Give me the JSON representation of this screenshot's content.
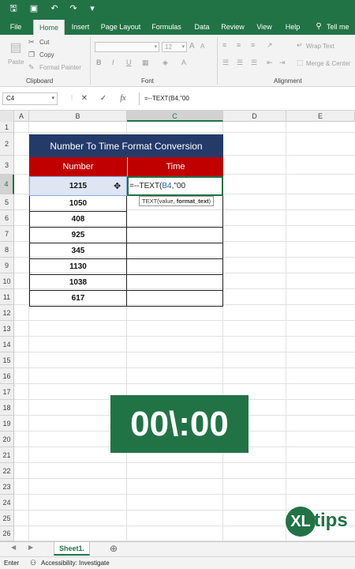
{
  "titlebar": {
    "quick_access": [
      {
        "name": "save-icon",
        "glyph": "🖫"
      },
      {
        "name": "autosave-icon",
        "glyph": "▣"
      },
      {
        "name": "undo-icon",
        "glyph": "↶"
      },
      {
        "name": "redo-icon",
        "glyph": "↷"
      },
      {
        "name": "customize-icon",
        "glyph": "▾"
      }
    ],
    "color": "#217346"
  },
  "ribbon": {
    "tabs": [
      "File",
      "Home",
      "Insert",
      "Page Layout",
      "Formulas",
      "Data",
      "Review",
      "View",
      "Help",
      "Tell me"
    ],
    "active_tab": "Home",
    "clipboard": {
      "paste": "Paste",
      "cut": "Cut",
      "copy": "Copy",
      "format_painter": "Format Painter",
      "label": "Clipboard"
    },
    "font": {
      "size": "12",
      "bold": "B",
      "italic": "I",
      "underline": "U",
      "label": "Font"
    },
    "alignment": {
      "wrap_text": "Wrap Text",
      "merge_center": "Merge & Center",
      "label": "Alignment"
    }
  },
  "formula_bar": {
    "name_box": "C4",
    "cancel": "✕",
    "enter": "✓",
    "fx": "fx",
    "formula": "=--TEXT(B4,\"00"
  },
  "sheet": {
    "columns": [
      "A",
      "B",
      "C",
      "D",
      "E"
    ],
    "selected_column": "C",
    "rows": [
      "1",
      "2",
      "3",
      "4",
      "5",
      "6",
      "7",
      "8",
      "9",
      "10",
      "11",
      "12",
      "13",
      "14",
      "15",
      "16",
      "17",
      "18",
      "19",
      "20",
      "21",
      "22",
      "23",
      "24",
      "25",
      "26"
    ],
    "selected_row": "4",
    "table": {
      "title": "Number To Time Format Conversion",
      "header_number": "Number",
      "header_time": "Time",
      "numbers": [
        "1215",
        "1050",
        "408",
        "925",
        "345",
        "1130",
        "1038",
        "617"
      ],
      "edit_prefix": "=--TEXT(",
      "edit_ref": "B4",
      "edit_suffix": ",\"00",
      "tooltip_fn": "TEXT(value, ",
      "tooltip_arg": "format_text",
      "tooltip_end": ")"
    }
  },
  "banner": {
    "text": "00\\:00"
  },
  "logo": {
    "mark": "XL",
    "text": "tips"
  },
  "sheet_tabs": {
    "active": "Sheet1.",
    "add": "⊕"
  },
  "status_bar": {
    "mode": "Enter",
    "accessibility": "Accessibility: Investigate"
  }
}
